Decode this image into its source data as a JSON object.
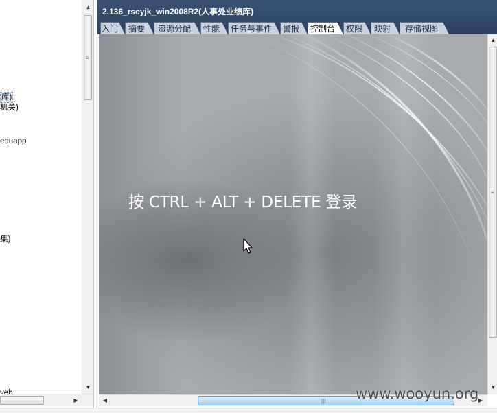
{
  "left_tree": {
    "nodes": [
      {
        "label": "库)",
        "selected": true
      },
      {
        "label": "机关)"
      },
      {
        "label": "eduapp"
      },
      {
        "label": "集)"
      },
      {
        "label": "veb"
      }
    ]
  },
  "console": {
    "title": "2.136_rscyjk_win2008R2(人事处业绩库)",
    "tabs": [
      {
        "label": "入门"
      },
      {
        "label": "摘要"
      },
      {
        "label": "资源分配"
      },
      {
        "label": "性能"
      },
      {
        "label": "任务与事件"
      },
      {
        "label": "警报"
      },
      {
        "label": "控制台",
        "active": true
      },
      {
        "label": "权限"
      },
      {
        "label": "映射"
      },
      {
        "label": "存储视图"
      }
    ],
    "remote_screen": {
      "login_hint": "按 CTRL + ALT + DELETE 登录",
      "cursor": "arrow-cursor-icon"
    }
  },
  "watermark": "www.wooyun.org",
  "colors": {
    "header_bg": "#34496a",
    "tab_bg": "#c9d1dc",
    "tab_active_bg": "#ffffff",
    "screen_bg": "#8d9195",
    "scroll_thumb_active": "#a9d2f0"
  },
  "icons": {
    "scroll_up": "scroll-up-arrow-icon",
    "scroll_down": "scroll-down-arrow-icon",
    "scroll_left": "scroll-left-arrow-icon",
    "scroll_right": "scroll-right-arrow-icon"
  }
}
